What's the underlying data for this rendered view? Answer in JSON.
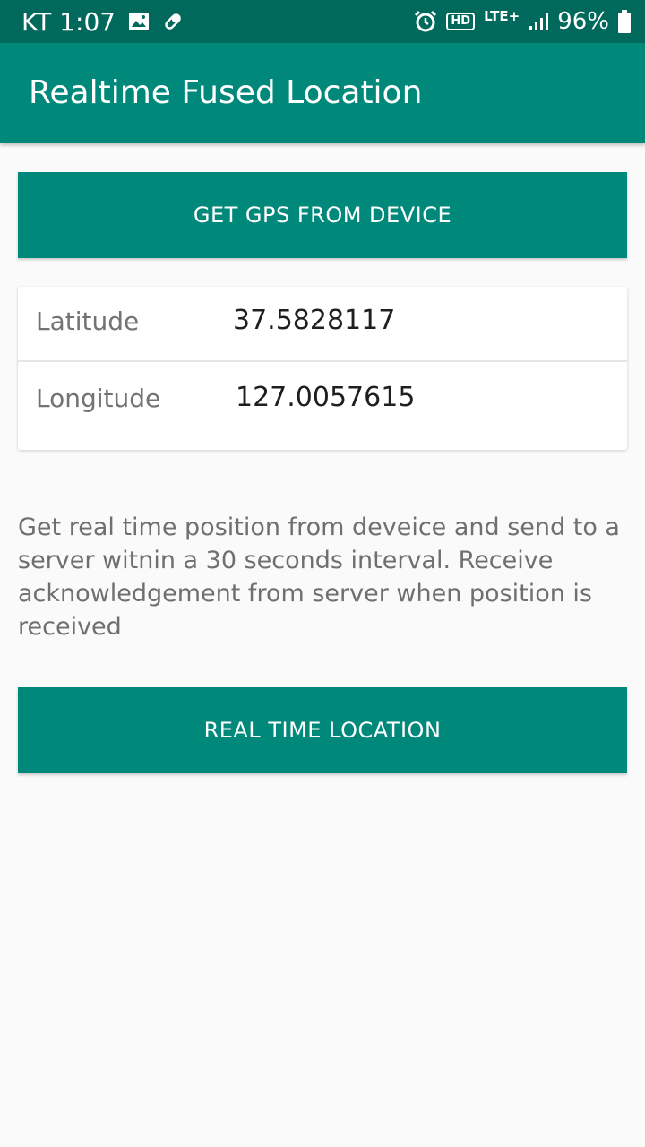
{
  "status_bar": {
    "carrier": "KT",
    "time": "1:07",
    "network": "LTE+",
    "hd_label": "HD",
    "battery": "96%",
    "icons": [
      "image-icon",
      "pill-icon",
      "alarm-icon",
      "hd-icon",
      "signal-icon",
      "battery-icon"
    ]
  },
  "app_bar": {
    "title": "Realtime Fused Location"
  },
  "buttons": {
    "get_gps": "GET GPS FROM DEVICE",
    "real_time": "REAL TIME LOCATION"
  },
  "location_card": {
    "latitude_label": "Latitude",
    "latitude_value": "37.5828117",
    "longitude_label": "Longitude",
    "longitude_value": "127.0057615"
  },
  "description": "Get real time position from deveice and send to a server witnin a 30 seconds interval. Receive acknowledgement from server when position is received",
  "colors": {
    "status_bar": "#00695c",
    "primary": "#00897b",
    "background": "#fafafa",
    "text_secondary": "#6f6f6f"
  }
}
